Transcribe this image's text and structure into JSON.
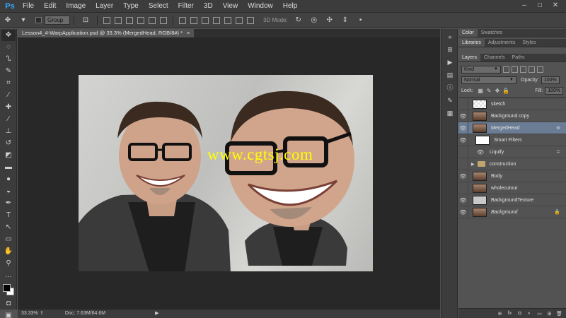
{
  "app": {
    "logo": "Ps"
  },
  "menu": [
    "File",
    "Edit",
    "Image",
    "Layer",
    "Type",
    "Select",
    "Filter",
    "3D",
    "View",
    "Window",
    "Help"
  ],
  "window_controls": [
    "–",
    "□",
    "✕"
  ],
  "options": {
    "auto_select_value": "Group",
    "mode_3d_label": "3D Mode:"
  },
  "document": {
    "tab_title": "Lesson4_4-WarpApplication.psd @ 33.3% (MergedHead, RGB/8#) *",
    "close_glyph": "×",
    "watermark": "www.cgtsj.com"
  },
  "status": {
    "zoom": "33.33%",
    "doc_info": "Doc: 7.63M/64.6M",
    "arrow": "▶"
  },
  "panels": {
    "top_tabs": [
      "Color",
      "Swatches"
    ],
    "mid_tabs": [
      "Libraries",
      "Adjustments",
      "Styles"
    ],
    "layer_tabs": [
      "Layers",
      "Channels",
      "Paths"
    ],
    "filter_kind": "Kind",
    "blend_mode": "Normal",
    "opacity_label": "Opacity:",
    "opacity_value": "100%",
    "lock_label": "Lock:",
    "fill_label": "Fill:",
    "fill_value": "100%",
    "footer_icons": [
      "⊕",
      "fx",
      "◘",
      "◐",
      "▭",
      "⊞",
      "🗑"
    ]
  },
  "layers": [
    {
      "name": "sketch",
      "visible": false,
      "thumb": "checker"
    },
    {
      "name": "Background copy",
      "visible": true,
      "thumb": "face"
    },
    {
      "name": "MergedHead",
      "visible": true,
      "thumb": "face",
      "selected": true
    },
    {
      "name": "Smart Filters",
      "visible": true,
      "thumb": "white",
      "sub": true
    },
    {
      "name": "Liquify",
      "visible": true,
      "thumb": "",
      "subsub": true
    },
    {
      "name": "construction",
      "visible": false,
      "thumb": "folder"
    },
    {
      "name": "Body",
      "visible": true,
      "thumb": "face"
    },
    {
      "name": "wholecutout",
      "visible": false,
      "thumb": "face"
    },
    {
      "name": "BackgroundTexture",
      "visible": true,
      "thumb": "grey"
    },
    {
      "name": "Background",
      "visible": true,
      "thumb": "face",
      "italic": true
    }
  ]
}
